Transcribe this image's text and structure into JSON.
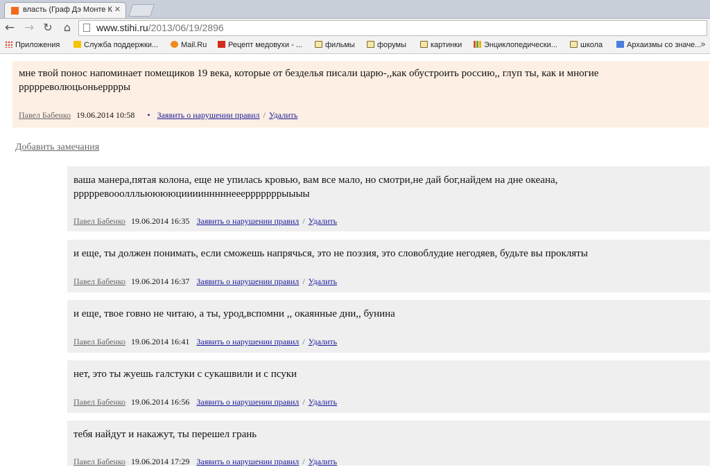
{
  "browser": {
    "tab_title": "власть (Граф Дэ Монте К",
    "url_host": "www.stihi.ru",
    "url_path": "/2013/06/19/2896",
    "bookmarks": [
      {
        "label": "Приложения",
        "icon": "apps-icon"
      },
      {
        "label": "Служба поддержки...",
        "icon": "yandex-icon"
      },
      {
        "label": "Mail.Ru",
        "icon": "mail-icon"
      },
      {
        "label": "Рецепт медовухи - ...",
        "icon": "recipe-icon"
      },
      {
        "label": "фильмы",
        "icon": "folder-icon"
      },
      {
        "label": "форумы",
        "icon": "folder-icon"
      },
      {
        "label": "картинки",
        "icon": "folder-icon"
      },
      {
        "label": "Энциклопедически...",
        "icon": "chart-icon"
      },
      {
        "label": "школа",
        "icon": "folder-icon"
      },
      {
        "label": "Архаизмы со значе...",
        "icon": "doc-icon"
      }
    ]
  },
  "main_comment": {
    "text": "мне твой понос напоминает помещиков 19 века, которые от безделья писали царю-,,как обустроить россию,, глуп ты, как и многие ррррреволюцьоньерррры",
    "author": "Павел Бабенко",
    "date": "19.06.2014 10:58",
    "bullet": "•",
    "report": "Заявить о нарушении правил",
    "separator": "/",
    "delete": "Удалить"
  },
  "add_remarks": "Добавить замечания",
  "replies": [
    {
      "text": "ваша манера,пятая колона, еще не упилась кровью, вам все мало, но смотри,не дай бог,найдем на дне океана, ррррревоооллльююююциииинннннееерррррррыыыы",
      "author": "Павел Бабенко",
      "date": "19.06.2014 16:35",
      "report": "Заявить о нарушении правил",
      "separator": "/",
      "delete": "Удалить"
    },
    {
      "text": "и еще, ты должен понимать, если сможешь напрячься, это не поэзия, это словоблудие негодяев, будьте вы прокляты",
      "author": "Павел Бабенко",
      "date": "19.06.2014 16:37",
      "report": "Заявить о нарушении правил",
      "separator": "/",
      "delete": "Удалить"
    },
    {
      "text": "и еще, твое говно не читаю, а ты, урод,вспомни ,, окаянные дни,, бунина",
      "author": "Павел Бабенко",
      "date": "19.06.2014 16:41",
      "report": "Заявить о нарушении правил",
      "separator": "/",
      "delete": "Удалить"
    },
    {
      "text": "нет, это ты жуешь галстуки с сукашвили и с псуки",
      "author": "Павел Бабенко",
      "date": "19.06.2014 16:56",
      "report": "Заявить о нарушении правил",
      "separator": "/",
      "delete": "Удалить"
    },
    {
      "text": "тебя найдут и накажут, ты перешел грань",
      "author": "Павел Бабенко",
      "date": "19.06.2014 17:29",
      "report": "Заявить о нарушении правил",
      "separator": "/",
      "delete": "Удалить"
    }
  ]
}
